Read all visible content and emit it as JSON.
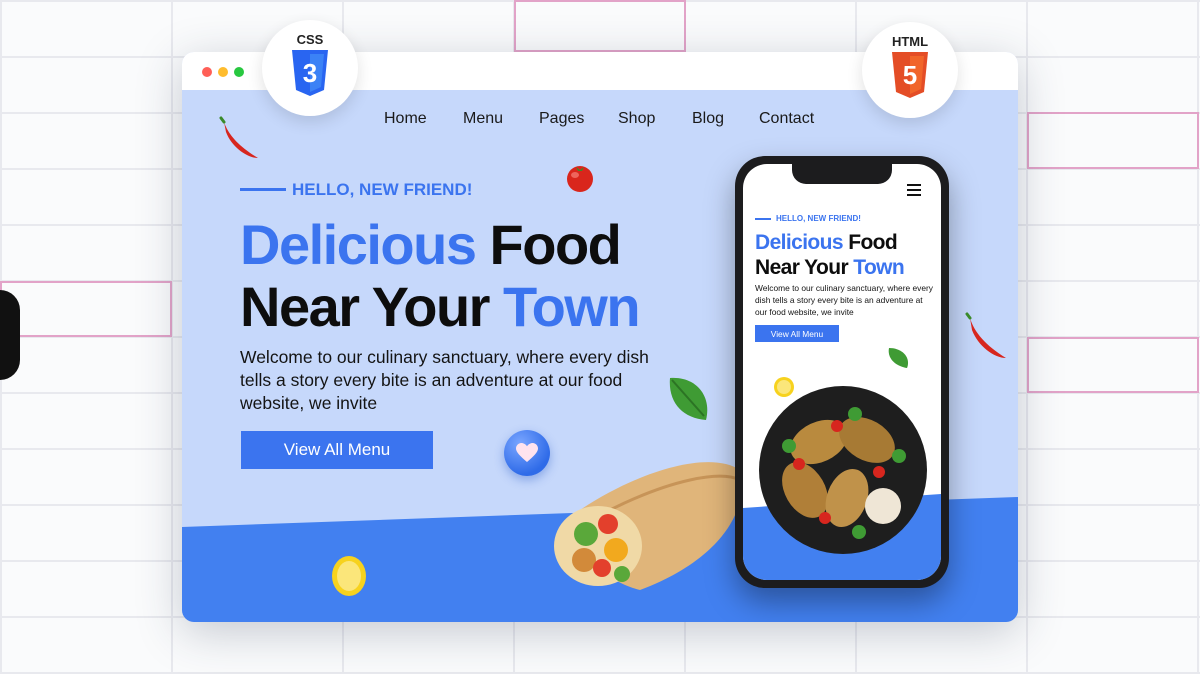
{
  "nav": {
    "items": [
      {
        "label": "Home"
      },
      {
        "label": "Menu"
      },
      {
        "label": "Pages"
      },
      {
        "label": "Shop"
      },
      {
        "label": "Blog"
      },
      {
        "label": "Contact"
      }
    ]
  },
  "hero": {
    "kicker": "HELLO, NEW FRIEND!",
    "heading": {
      "line1_blue": "Delicious",
      "line1_black": "Food",
      "line2_black": "Near Your",
      "line2_blue": "Town"
    },
    "description": "Welcome to our culinary sanctuary, where every dish tells a story every bite is an adventure at our food website, we invite",
    "cta_label": "View All Menu"
  },
  "mobile": {
    "kicker": "HELLO, NEW FRIEND!",
    "heading": {
      "line1_blue": "Delicious",
      "line1_black": "Food",
      "line2_black": "Near Your",
      "line2_blue": "Town"
    },
    "description": "Welcome to our culinary sanctuary, where every dish tells a story every bite is an adventure at our food website, we invite",
    "cta_label": "View All Menu",
    "menu_icon": "hamburger-menu-icon"
  },
  "badges": {
    "css": {
      "label": "CSS",
      "glyph": "3",
      "icon": "css3-logo-icon",
      "color": "#2965f1"
    },
    "html": {
      "label": "HTML",
      "glyph": "5",
      "icon": "html5-logo-icon",
      "color": "#e44d26"
    }
  },
  "window": {
    "controls": [
      "close",
      "minimize",
      "maximize"
    ]
  },
  "colors": {
    "accent": "#3b74ef",
    "hero_background": "#c6d8fb",
    "wedge": "#4280f0"
  }
}
